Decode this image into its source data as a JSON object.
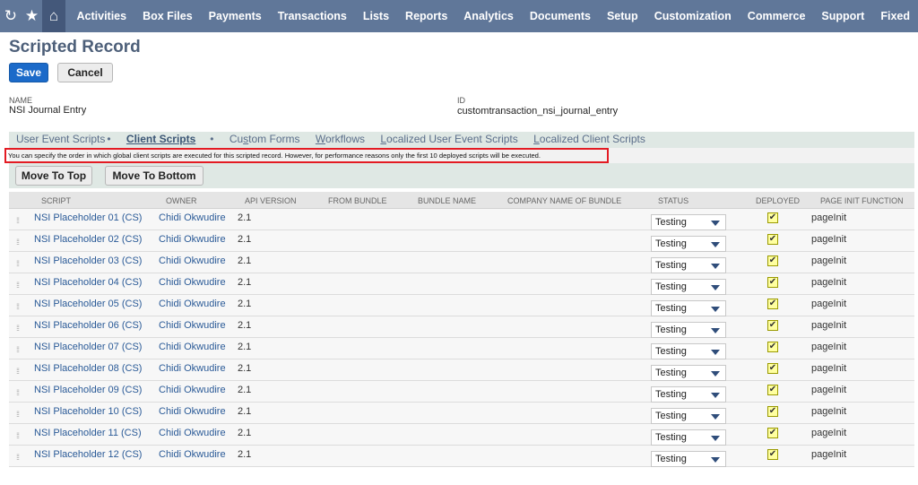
{
  "nav": {
    "items": [
      "Activities",
      "Box Files",
      "Payments",
      "Transactions",
      "Lists",
      "Reports",
      "Analytics",
      "Documents",
      "Setup",
      "Customization",
      "Commerce",
      "Support",
      "Fixed"
    ]
  },
  "page": {
    "title": "Scripted Record",
    "save_label": "Save",
    "cancel_label": "Cancel"
  },
  "fields": {
    "name_label": "NAME",
    "name_value": "NSI Journal Entry",
    "id_label": "ID",
    "id_value": "customtransaction_nsi_journal_entry"
  },
  "subtabs": {
    "user_event": "User Event Scripts",
    "client": "Client Scripts",
    "custom_forms_a": "Cu",
    "custom_forms_b": "s",
    "custom_forms_c": "tom Forms",
    "workflows_a": "W",
    "workflows_b": "orkflows",
    "localized_ue_a": "L",
    "localized_ue_b": "ocalized User Event Scripts",
    "localized_cs_a": "L",
    "localized_cs_b": "ocalized Client Scripts",
    "dot": "•"
  },
  "notice": "You can specify the order in which global client scripts are executed for this scripted record. However, for performance reasons only the first 10 deployed scripts will be executed.",
  "toolbar": {
    "move_top": "Move To Top",
    "move_bottom": "Move To Bottom"
  },
  "columns": [
    "SCRIPT",
    "OWNER",
    "API VERSION",
    "FROM BUNDLE",
    "BUNDLE NAME",
    "COMPANY NAME OF BUNDLE",
    "STATUS",
    "DEPLOYED",
    "PAGE INIT FUNCTION"
  ],
  "rows": [
    {
      "script": "NSI Placeholder 01 (CS)",
      "owner": "Chidi Okwudire",
      "api": "2.1",
      "status": "Testing",
      "deployed": true,
      "page_init": "pageInit"
    },
    {
      "script": "NSI Placeholder 02 (CS)",
      "owner": "Chidi Okwudire",
      "api": "2.1",
      "status": "Testing",
      "deployed": true,
      "page_init": "pageInit"
    },
    {
      "script": "NSI Placeholder 03 (CS)",
      "owner": "Chidi Okwudire",
      "api": "2.1",
      "status": "Testing",
      "deployed": true,
      "page_init": "pageInit"
    },
    {
      "script": "NSI Placeholder 04 (CS)",
      "owner": "Chidi Okwudire",
      "api": "2.1",
      "status": "Testing",
      "deployed": true,
      "page_init": "pageInit"
    },
    {
      "script": "NSI Placeholder 05 (CS)",
      "owner": "Chidi Okwudire",
      "api": "2.1",
      "status": "Testing",
      "deployed": true,
      "page_init": "pageInit"
    },
    {
      "script": "NSI Placeholder 06 (CS)",
      "owner": "Chidi Okwudire",
      "api": "2.1",
      "status": "Testing",
      "deployed": true,
      "page_init": "pageInit"
    },
    {
      "script": "NSI Placeholder 07 (CS)",
      "owner": "Chidi Okwudire",
      "api": "2.1",
      "status": "Testing",
      "deployed": true,
      "page_init": "pageInit"
    },
    {
      "script": "NSI Placeholder 08 (CS)",
      "owner": "Chidi Okwudire",
      "api": "2.1",
      "status": "Testing",
      "deployed": true,
      "page_init": "pageInit"
    },
    {
      "script": "NSI Placeholder 09 (CS)",
      "owner": "Chidi Okwudire",
      "api": "2.1",
      "status": "Testing",
      "deployed": true,
      "page_init": "pageInit"
    },
    {
      "script": "NSI Placeholder 10 (CS)",
      "owner": "Chidi Okwudire",
      "api": "2.1",
      "status": "Testing",
      "deployed": true,
      "page_init": "pageInit"
    },
    {
      "script": "NSI Placeholder 11 (CS)",
      "owner": "Chidi Okwudire",
      "api": "2.1",
      "status": "Testing",
      "deployed": true,
      "page_init": "pageInit"
    },
    {
      "script": "NSI Placeholder 12 (CS)",
      "owner": "Chidi Okwudire",
      "api": "2.1",
      "status": "Testing",
      "deployed": true,
      "page_init": "pageInit"
    }
  ],
  "colors": {
    "nav_bg": "#607799",
    "save_bg": "#1b6ac9",
    "notice_border": "#e31b23",
    "deployed_highlight": "#fff200"
  }
}
